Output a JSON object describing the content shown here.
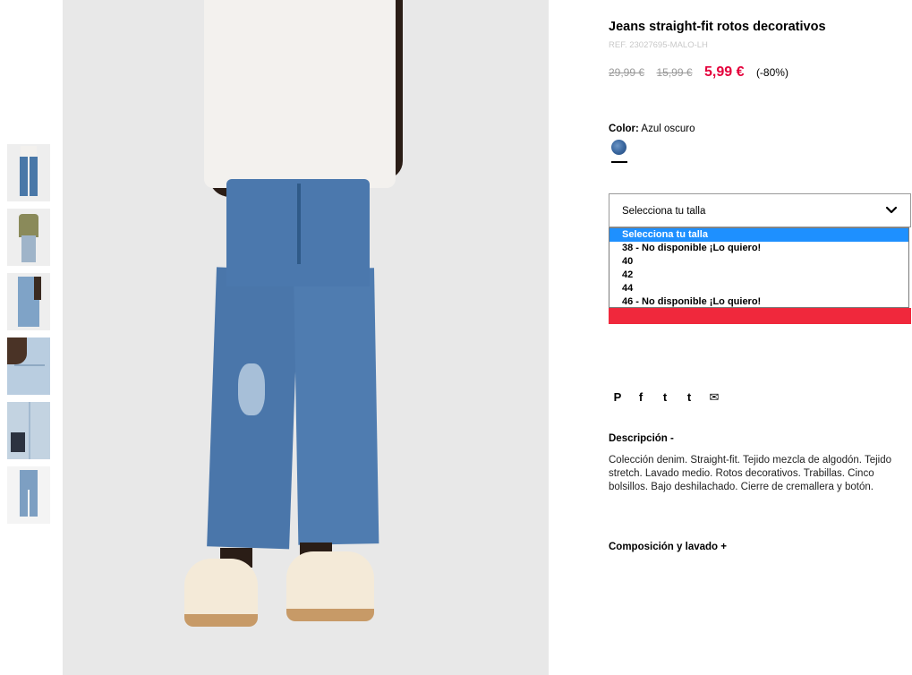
{
  "product": {
    "title": "Jeans straight-fit rotos decorativos",
    "ref": "REF. 23027695-MALO-LH",
    "prices": {
      "original": "29,99 €",
      "previous": "15,99 €",
      "current": "5,99 €",
      "discount": "(-80%)"
    }
  },
  "color": {
    "label": "Color:",
    "value": "Azul oscuro",
    "swatch_color": "#3b68a0"
  },
  "size_select": {
    "value": "Selecciona tu talla",
    "options": [
      "Selecciona tu talla",
      "38 - No disponible ¡Lo quiero!",
      "40",
      "42",
      "44",
      "46 - No disponible ¡Lo quiero!"
    ],
    "selected_index": 0
  },
  "share": {
    "icons": [
      "pinterest-icon",
      "facebook-icon",
      "twitter-icon",
      "tumblr-icon",
      "email-icon"
    ],
    "glyphs": [
      "P",
      "f",
      "t",
      "t",
      "✉"
    ]
  },
  "description": {
    "heading": "Descripción -",
    "text": "Colección denim. Straight-fit. Tejido mezcla de algodón. Tejido stretch. Lavado medio. Rotos decorativos. Trabillas. Cinco bolsillos. Bajo deshilachado. Cierre de cremallera y botón."
  },
  "composition": {
    "heading": "Composición y lavado +"
  },
  "colors": {
    "sale": "#e4003b",
    "add_button": "#f0283c",
    "option_highlight": "#1e90ff",
    "ref_text": "#c8c8c8"
  }
}
